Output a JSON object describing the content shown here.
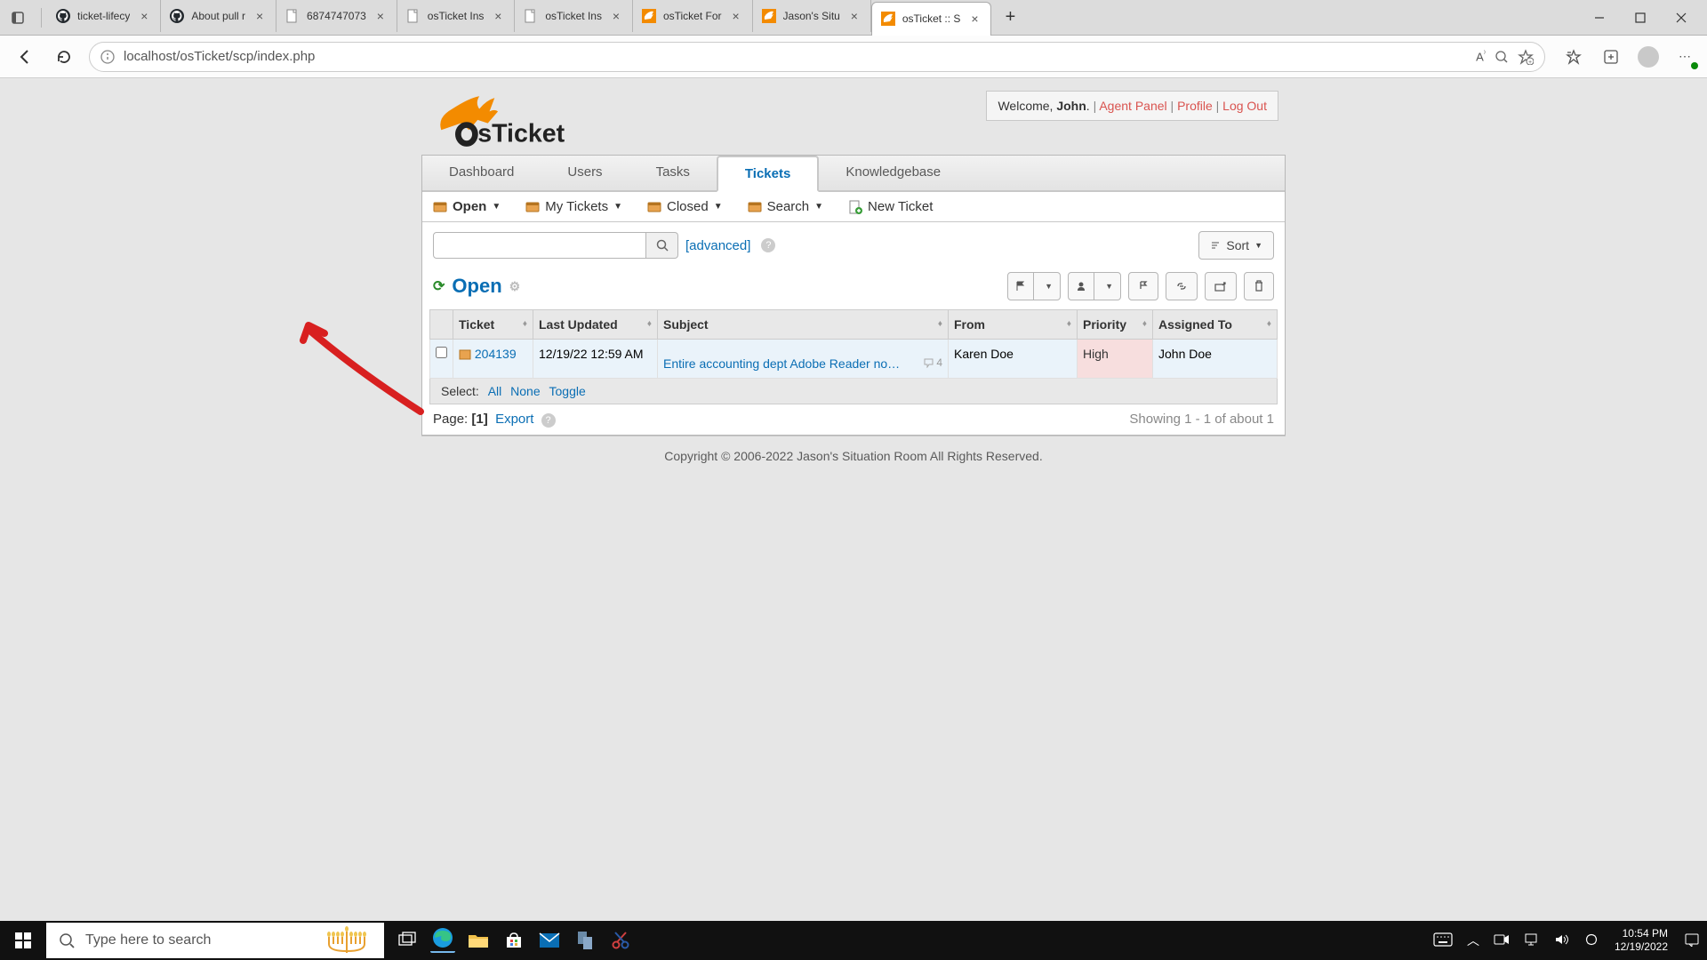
{
  "browser": {
    "tabs": [
      {
        "title": "ticket-lifecy",
        "fav": "github"
      },
      {
        "title": "About pull r",
        "fav": "github"
      },
      {
        "title": "6874747073",
        "fav": "doc"
      },
      {
        "title": "osTicket Ins",
        "fav": "doc"
      },
      {
        "title": "osTicket Ins",
        "fav": "doc"
      },
      {
        "title": "osTicket For",
        "fav": "osticket"
      },
      {
        "title": "Jason's Situ",
        "fav": "osticket"
      },
      {
        "title": "osTicket :: S",
        "fav": "osticket",
        "active": true
      }
    ],
    "url": "localhost/osTicket/scp/index.php"
  },
  "header": {
    "welcome_prefix": "Welcome, ",
    "welcome_name": "John",
    "welcome_period": ".",
    "agent_panel": "Agent Panel",
    "profile": "Profile",
    "logout": "Log Out"
  },
  "nav": {
    "tabs": [
      "Dashboard",
      "Users",
      "Tasks",
      "Tickets",
      "Knowledgebase"
    ],
    "active": "Tickets",
    "sub": {
      "open": "Open",
      "mytickets": "My Tickets",
      "closed": "Closed",
      "search": "Search",
      "newticket": "New Ticket"
    }
  },
  "search": {
    "advanced": "[advanced]",
    "sort": "Sort"
  },
  "queue": {
    "title": "Open"
  },
  "table": {
    "headers": {
      "ticket": "Ticket",
      "last_updated": "Last Updated",
      "subject": "Subject",
      "from": "From",
      "priority": "Priority",
      "assigned": "Assigned To"
    },
    "rows": [
      {
        "number": "204139",
        "last_updated": "12/19/22 12:59 AM",
        "subject": "Entire accounting dept Adobe Reader no…",
        "thread_count": "4",
        "from": "Karen Doe",
        "priority": "High",
        "assigned": "John Doe"
      }
    ]
  },
  "footer": {
    "select_label": "Select:",
    "select_all": "All",
    "select_none": "None",
    "select_toggle": "Toggle",
    "page_label": "Page:",
    "page_current": "[1]",
    "export": "Export",
    "showing": "Showing 1 - 1 of about 1",
    "copyright": "Copyright © 2006-2022 Jason's Situation Room All Rights Reserved."
  },
  "taskbar": {
    "search_placeholder": "Type here to search",
    "time": "10:54 PM",
    "date": "12/19/2022"
  }
}
